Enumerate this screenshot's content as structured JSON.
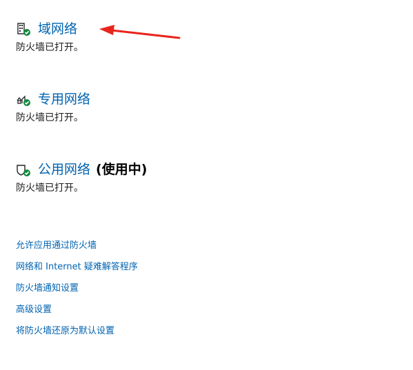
{
  "networks": [
    {
      "title": "域网络",
      "suffix": "",
      "status": "防火墙已打开。",
      "icon": "domain-building-icon"
    },
    {
      "title": "专用网络",
      "suffix": "",
      "status": "防火墙已打开。",
      "icon": "private-network-icon"
    },
    {
      "title": "公用网络",
      "suffix": "(使用中)",
      "status": "防火墙已打开。",
      "icon": "public-network-icon"
    }
  ],
  "links": [
    "允许应用通过防火墙",
    "网络和 Internet 疑难解答程序",
    "防火墙通知设置",
    "高级设置",
    "将防火墙还原为默认设置"
  ],
  "colors": {
    "link": "#0063b1",
    "check": "#10893e",
    "arrow": "#e8251b"
  }
}
